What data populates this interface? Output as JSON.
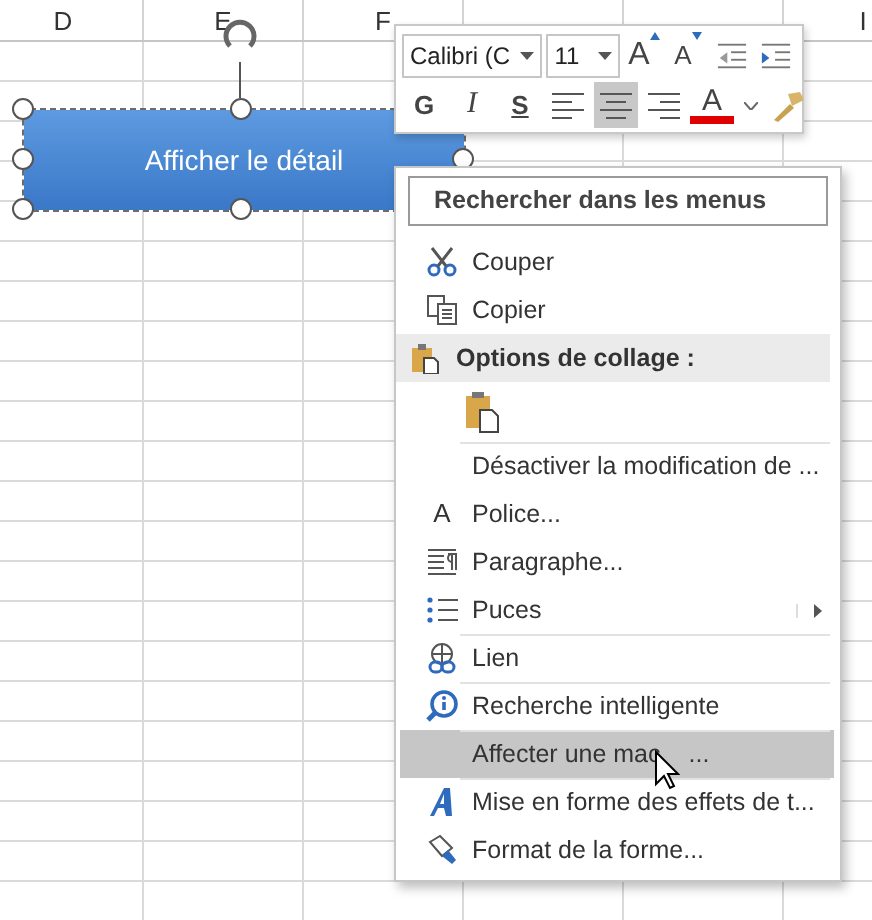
{
  "column_headers": [
    "D",
    "E",
    "F"
  ],
  "column_headers_right": [
    "I"
  ],
  "shape": {
    "label": "Afficher le détail",
    "selected": true
  },
  "mini_toolbar": {
    "font": "Calibri (C",
    "size": "11",
    "row_1": [
      {
        "kind": "grow",
        "label": "A"
      },
      {
        "kind": "shrink",
        "label": "A"
      },
      {
        "kind": "outdent"
      },
      {
        "kind": "indent"
      }
    ],
    "row_2": [
      {
        "kind": "bold",
        "label": "G",
        "selected": false
      },
      {
        "kind": "italic",
        "label": "I",
        "selected": false
      },
      {
        "kind": "underline",
        "label": "S",
        "selected": false
      },
      {
        "kind": "align-left",
        "selected": false
      },
      {
        "kind": "align-center",
        "selected": true
      },
      {
        "kind": "align-right",
        "selected": false
      },
      {
        "kind": "font-color",
        "label": "A",
        "selected": false
      },
      {
        "kind": "caret",
        "selected": false
      },
      {
        "kind": "painter",
        "selected": false
      }
    ]
  },
  "context_menu": {
    "search_placeholder": "Rechercher dans les menus",
    "items": [
      {
        "kind": "cut",
        "label": "Couper",
        "selected": false,
        "separator_before": false,
        "submenu": false
      },
      {
        "kind": "copy",
        "label": "Copier",
        "selected": false,
        "separator_before": false,
        "submenu": false
      },
      {
        "kind": "header",
        "label": "Options de collage :",
        "selected": false,
        "separator_before": false,
        "submenu": false
      },
      {
        "kind": "paste",
        "selected": false,
        "separator_before": false,
        "submenu": false
      },
      {
        "kind": "plain",
        "label": "Désactiver la modification de ...",
        "selected": false,
        "separator_before": true,
        "submenu": false
      },
      {
        "kind": "font",
        "icon_text": "A",
        "label": "Police...",
        "selected": false,
        "separator_before": false,
        "submenu": false
      },
      {
        "kind": "paragraph",
        "label": "Paragraphe...",
        "selected": false,
        "separator_before": false,
        "submenu": false
      },
      {
        "kind": "bullets",
        "label": "Puces",
        "selected": false,
        "separator_before": false,
        "submenu": true
      },
      {
        "kind": "link",
        "label": "Lien",
        "selected": false,
        "separator_before": true,
        "submenu": false
      },
      {
        "kind": "lookup",
        "label": "Recherche intelligente",
        "selected": false,
        "separator_before": true,
        "submenu": false
      },
      {
        "kind": "plain",
        "label": "Affecter une mac",
        "label_tail": "...",
        "selected": true,
        "separator_before": true,
        "submenu": false
      },
      {
        "kind": "effects",
        "label": "Mise en forme des effets de t...",
        "selected": false,
        "separator_before": true,
        "submenu": false
      },
      {
        "kind": "format",
        "label": "Format de la forme...",
        "selected": false,
        "separator_before": false,
        "submenu": false
      }
    ]
  }
}
